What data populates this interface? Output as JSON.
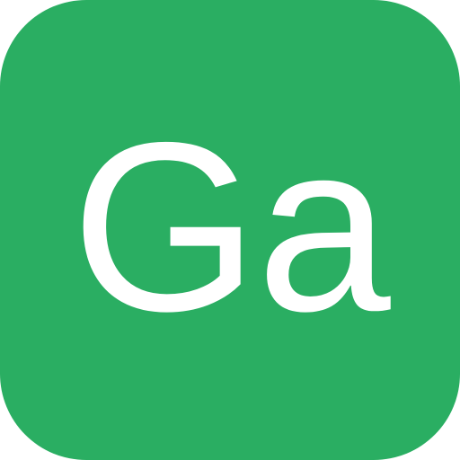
{
  "icon": {
    "label": "Ga",
    "background_color": "#2aae62",
    "text_color": "#ffffff"
  }
}
